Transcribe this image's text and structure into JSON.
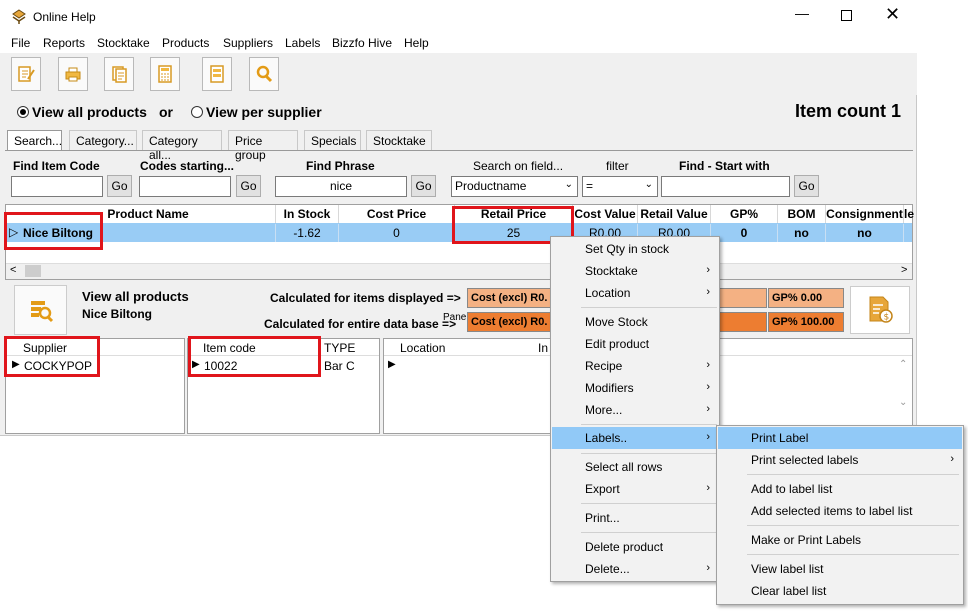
{
  "window": {
    "title": "Online Help"
  },
  "menubar": [
    "File",
    "Reports",
    "Stocktake",
    "Products",
    "Suppliers",
    "Labels",
    "Bizzfo Hive",
    "Help"
  ],
  "toolbar_icons": [
    "edit-icon",
    "print-icon",
    "copy-icon",
    "calculator-icon",
    "report-icon",
    "search-icon"
  ],
  "view": {
    "all_products": "View all products",
    "or": "or",
    "per_supplier": "View per supplier",
    "item_count": "Item count 1"
  },
  "tabs": [
    "Search...",
    "Category...",
    "Category all...",
    "Price group",
    "Specials",
    "Stocktake"
  ],
  "search": {
    "find_item_code_label": "Find Item Code",
    "find_item_code_value": "",
    "codes_starting_label": "Codes starting...",
    "codes_starting_value": "",
    "find_phrase_label": "Find Phrase",
    "find_phrase_value": "nice",
    "search_on_field_label": "Search on field...",
    "search_on_field_value": "Productname",
    "filter_label": "filter",
    "filter_value": "=",
    "find_start_label": "Find - Start with",
    "find_start_value": "",
    "go_label": "Go"
  },
  "grid": {
    "headers": [
      "Product Name",
      "In Stock",
      "Cost Price",
      "Retail Price",
      "Cost Value",
      "Retail Value",
      "GP%",
      "BOM",
      "Consignment",
      "le"
    ],
    "row": {
      "product_name": "Nice Biltong",
      "in_stock": "-1.62",
      "cost_price": "0",
      "retail_price": "25",
      "cost_value": "R0.00",
      "retail_value": "R0.00",
      "gp": "0",
      "bom": "no",
      "consignment": "no"
    }
  },
  "summary": {
    "view_label": "View all products",
    "product": "Nice Biltong",
    "calc_displayed": "Calculated for items displayed =>",
    "calc_entire": "Calculated for entire data base =>",
    "pane_label": "Pane",
    "cost1": "Cost (excl) R0.",
    "cost2": "Cost (excl) R0.",
    "gp1": "GP% 0.00",
    "gp2": "GP% 100.00"
  },
  "supplier_grid": {
    "header": "Supplier",
    "value": "COCKYPOP"
  },
  "itemcode_grid": {
    "header": "Item code",
    "value": "10022",
    "type_header": "TYPE",
    "type_value": "Bar C"
  },
  "location_grid": {
    "header": "Location",
    "in_header": "In"
  },
  "context_menu": [
    "Set Qty in stock",
    "Stocktake",
    "Location",
    "Move Stock",
    "Edit product",
    "Recipe",
    "Modifiers",
    "More...",
    "Labels..",
    "Select all rows",
    "Export",
    "Print...",
    "Delete product",
    "Delete..."
  ],
  "labels_submenu": [
    "Print Label",
    "Print selected labels",
    "Add to label list",
    "Add selected items to label list",
    "Make or Print Labels",
    "View label list",
    "Clear label list"
  ],
  "colors": {
    "highlight": "#91c9f7",
    "orange_light": "#f4b183",
    "orange_dark": "#ed7d31",
    "red_box": "#e0151b"
  }
}
